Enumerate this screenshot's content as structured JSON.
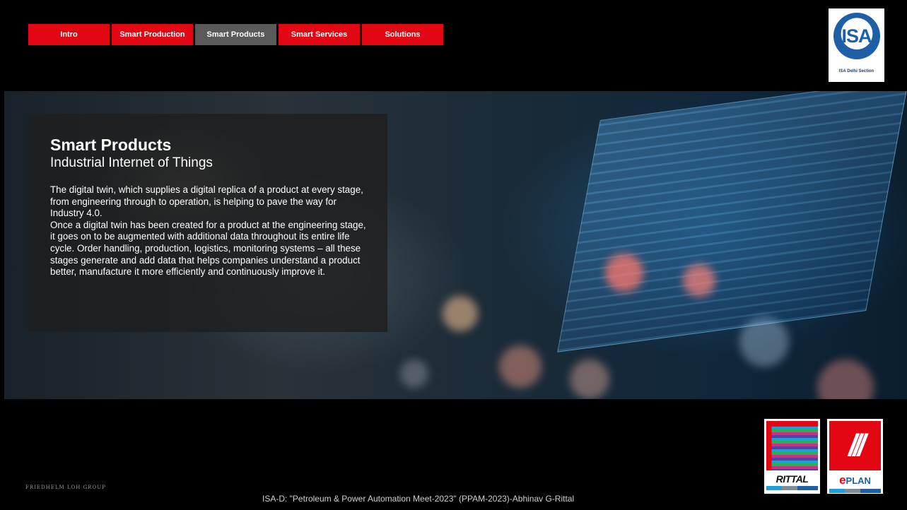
{
  "nav": {
    "tabs": [
      {
        "label": "Intro",
        "active": false
      },
      {
        "label": "Smart Production",
        "active": false
      },
      {
        "label": "Smart Products",
        "active": true
      },
      {
        "label": "Smart Services",
        "active": false
      },
      {
        "label": "Solutions",
        "active": false
      }
    ]
  },
  "logo": {
    "text": "ISA",
    "caption": "ISA Delhi Section"
  },
  "panel": {
    "title": "Smart Products",
    "subtitle": "Industrial Internet of Things",
    "paragraph1": "The digital twin, which supplies a digital replica of a product at every stage, from engineering through to operation, is helping to pave the way for Industry 4.0.",
    "paragraph2": "Once a digital twin has been created for a product at the engineering stage, it goes on to be augmented with additional data throughout its entire life cycle. Order handling, production, logistics, monitoring systems – all these stages generate and add data that helps companies understand a product better, manufacture it more efficiently and continuously improve it."
  },
  "partners": {
    "rittal": "RITTAL",
    "eplan_e": "e",
    "eplan_rest": "PLAN"
  },
  "footer": {
    "left": "FRIEDHELM LOH GROUP",
    "center": "ISA-D: \"Petroleum & Power Automation Meet-2023\" (PPAM-2023)-Abhinav G-Rittal"
  },
  "colors": {
    "accent": "#e30613",
    "active_tab": "#5a5a5a",
    "isa_blue": "#1f5fa6"
  }
}
